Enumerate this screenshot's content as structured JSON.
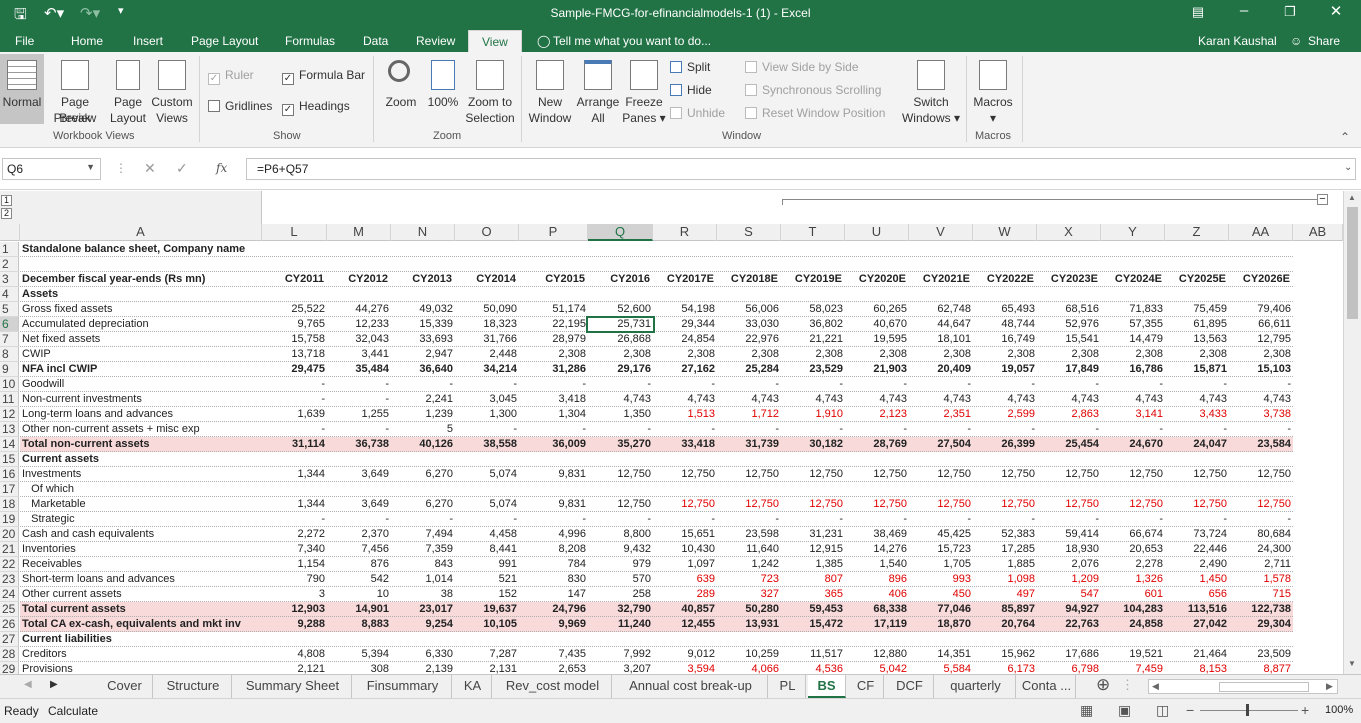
{
  "title_bar": {
    "title": "Sample-FMCG-for-efinancialmodels-1 (1) - Excel"
  },
  "menu": {
    "items": [
      "File",
      "Home",
      "Insert",
      "Page Layout",
      "Formulas",
      "Data",
      "Review",
      "View"
    ],
    "active": "View",
    "tell_me": "Tell me what you want to do...",
    "user": "Karan Kaushal",
    "share": "Share"
  },
  "ribbon": {
    "normal": "Normal",
    "page_break_1": "Page Break",
    "page_break_2": "Preview",
    "page_layout_1": "Page",
    "page_layout_2": "Layout",
    "custom_views_1": "Custom",
    "custom_views_2": "Views",
    "workbook_views": "Workbook Views",
    "ruler": "Ruler",
    "formula_bar": "Formula Bar",
    "gridlines": "Gridlines",
    "headings": "Headings",
    "show": "Show",
    "zoom": "Zoom",
    "zoom100": "100%",
    "zoom_sel_1": "Zoom to",
    "zoom_sel_2": "Selection",
    "zoom_group": "Zoom",
    "new_window_1": "New",
    "new_window_2": "Window",
    "arrange_1": "Arrange",
    "arrange_2": "All",
    "freeze_1": "Freeze",
    "freeze_2": "Panes",
    "split": "Split",
    "hide": "Hide",
    "unhide": "Unhide",
    "side_by_side": "View Side by Side",
    "sync_scroll": "Synchronous Scrolling",
    "reset_window": "Reset Window Position",
    "switch_1": "Switch",
    "switch_2": "Windows",
    "window_group": "Window",
    "macros": "Macros",
    "macros_group": "Macros"
  },
  "formula_bar": {
    "name_box": "Q6",
    "formula": "=P6+Q57"
  },
  "outline_levels": [
    "1",
    "2"
  ],
  "column_headers": [
    "A",
    "L",
    "M",
    "N",
    "O",
    "P",
    "Q",
    "R",
    "S",
    "T",
    "U",
    "V",
    "W",
    "X",
    "Y",
    "Z",
    "AA",
    "AB"
  ],
  "selected_cell": "Q6",
  "rows": [
    {
      "n": "1",
      "label": "Standalone balance sheet, Company name",
      "style": "bold",
      "values": []
    },
    {
      "n": "2",
      "label": "",
      "values": []
    },
    {
      "n": "3",
      "label": "December fiscal year-ends (Rs mn)",
      "style": "bold",
      "values": [
        "CY2011",
        "CY2012",
        "CY2013",
        "CY2014",
        "CY2015",
        "CY2016",
        "CY2017E",
        "CY2018E",
        "CY2019E",
        "CY2020E",
        "CY2021E",
        "CY2022E",
        "CY2023E",
        "CY2024E",
        "CY2025E",
        "CY2026E"
      ]
    },
    {
      "n": "4",
      "label": "Assets",
      "style": "bold",
      "values": []
    },
    {
      "n": "5",
      "label": "Gross fixed assets",
      "values": [
        "25,522",
        "44,276",
        "49,032",
        "50,090",
        "51,174",
        "52,600",
        "54,198",
        "56,006",
        "58,023",
        "60,265",
        "62,748",
        "65,493",
        "68,516",
        "71,833",
        "75,459",
        "79,406"
      ]
    },
    {
      "n": "6",
      "label": "Accumulated depreciation",
      "values": [
        "9,765",
        "12,233",
        "15,339",
        "18,323",
        "22,195",
        "25,731",
        "29,344",
        "33,030",
        "36,802",
        "40,670",
        "44,647",
        "48,744",
        "52,976",
        "57,355",
        "61,895",
        "66,611"
      ]
    },
    {
      "n": "7",
      "label": "Net fixed assets",
      "values": [
        "15,758",
        "32,043",
        "33,693",
        "31,766",
        "28,979",
        "26,868",
        "24,854",
        "22,976",
        "21,221",
        "19,595",
        "18,101",
        "16,749",
        "15,541",
        "14,479",
        "13,563",
        "12,795"
      ]
    },
    {
      "n": "8",
      "label": "CWIP",
      "values": [
        "13,718",
        "3,441",
        "2,947",
        "2,448",
        "2,308",
        "2,308",
        "2,308",
        "2,308",
        "2,308",
        "2,308",
        "2,308",
        "2,308",
        "2,308",
        "2,308",
        "2,308",
        "2,308"
      ]
    },
    {
      "n": "9",
      "label": "NFA incl CWIP",
      "style": "bold",
      "values": [
        "29,475",
        "35,484",
        "36,640",
        "34,214",
        "31,286",
        "29,176",
        "27,162",
        "25,284",
        "23,529",
        "21,903",
        "20,409",
        "19,057",
        "17,849",
        "16,786",
        "15,871",
        "15,103"
      ]
    },
    {
      "n": "10",
      "label": "Goodwill",
      "values": [
        "-",
        "-",
        "-",
        "-",
        "-",
        "-",
        "-",
        "-",
        "-",
        "-",
        "-",
        "-",
        "-",
        "-",
        "-",
        "-"
      ]
    },
    {
      "n": "11",
      "label": "Non-current investments",
      "values": [
        "-",
        "-",
        "2,241",
        "3,045",
        "3,418",
        "4,743",
        "4,743",
        "4,743",
        "4,743",
        "4,743",
        "4,743",
        "4,743",
        "4,743",
        "4,743",
        "4,743",
        "4,743"
      ]
    },
    {
      "n": "12",
      "label": "Long-term loans and advances",
      "values": [
        "1,639",
        "1,255",
        "1,239",
        "1,300",
        "1,304",
        "1,350",
        "1,513",
        "1,712",
        "1,910",
        "2,123",
        "2,351",
        "2,599",
        "2,863",
        "3,141",
        "3,433",
        "3,738"
      ],
      "red_from": 6
    },
    {
      "n": "13",
      "label": "Other non-current assets + misc exp",
      "values": [
        "-",
        "-",
        "5",
        "-",
        "-",
        "-",
        "-",
        "-",
        "-",
        "-",
        "-",
        "-",
        "-",
        "-",
        "-",
        "-"
      ]
    },
    {
      "n": "14",
      "label": "Total non-current assets",
      "style": "bold pink",
      "values": [
        "31,114",
        "36,738",
        "40,126",
        "38,558",
        "36,009",
        "35,270",
        "33,418",
        "31,739",
        "30,182",
        "28,769",
        "27,504",
        "26,399",
        "25,454",
        "24,670",
        "24,047",
        "23,584"
      ]
    },
    {
      "n": "15",
      "label": "Current assets",
      "style": "bold",
      "values": []
    },
    {
      "n": "16",
      "label": "Investments",
      "values": [
        "1,344",
        "3,649",
        "6,270",
        "5,074",
        "9,831",
        "12,750",
        "12,750",
        "12,750",
        "12,750",
        "12,750",
        "12,750",
        "12,750",
        "12,750",
        "12,750",
        "12,750",
        "12,750"
      ]
    },
    {
      "n": "17",
      "label": "   Of which",
      "values": []
    },
    {
      "n": "18",
      "label": "   Marketable",
      "values": [
        "1,344",
        "3,649",
        "6,270",
        "5,074",
        "9,831",
        "12,750",
        "12,750",
        "12,750",
        "12,750",
        "12,750",
        "12,750",
        "12,750",
        "12,750",
        "12,750",
        "12,750",
        "12,750"
      ],
      "red_from": 6
    },
    {
      "n": "19",
      "label": "   Strategic",
      "values": [
        "-",
        "-",
        "-",
        "-",
        "-",
        "-",
        "-",
        "-",
        "-",
        "-",
        "-",
        "-",
        "-",
        "-",
        "-",
        "-"
      ]
    },
    {
      "n": "20",
      "label": "Cash and cash equivalents",
      "values": [
        "2,272",
        "2,370",
        "7,494",
        "4,458",
        "4,996",
        "8,800",
        "15,651",
        "23,598",
        "31,231",
        "38,469",
        "45,425",
        "52,383",
        "59,414",
        "66,674",
        "73,724",
        "80,684"
      ]
    },
    {
      "n": "21",
      "label": "Inventories",
      "values": [
        "7,340",
        "7,456",
        "7,359",
        "8,441",
        "8,208",
        "9,432",
        "10,430",
        "11,640",
        "12,915",
        "14,276",
        "15,723",
        "17,285",
        "18,930",
        "20,653",
        "22,446",
        "24,300"
      ]
    },
    {
      "n": "22",
      "label": "Receivables",
      "values": [
        "1,154",
        "876",
        "843",
        "991",
        "784",
        "979",
        "1,097",
        "1,242",
        "1,385",
        "1,540",
        "1,705",
        "1,885",
        "2,076",
        "2,278",
        "2,490",
        "2,711"
      ]
    },
    {
      "n": "23",
      "label": "Short-term loans and advances",
      "values": [
        "790",
        "542",
        "1,014",
        "521",
        "830",
        "570",
        "639",
        "723",
        "807",
        "896",
        "993",
        "1,098",
        "1,209",
        "1,326",
        "1,450",
        "1,578"
      ],
      "red_from": 6
    },
    {
      "n": "24",
      "label": "Other current assets",
      "values": [
        "3",
        "10",
        "38",
        "152",
        "147",
        "258",
        "289",
        "327",
        "365",
        "406",
        "450",
        "497",
        "547",
        "601",
        "656",
        "715"
      ],
      "red_from": 6
    },
    {
      "n": "25",
      "label": "Total current assets",
      "style": "bold pink",
      "values": [
        "12,903",
        "14,901",
        "23,017",
        "19,637",
        "24,796",
        "32,790",
        "40,857",
        "50,280",
        "59,453",
        "68,338",
        "77,046",
        "85,897",
        "94,927",
        "104,283",
        "113,516",
        "122,738"
      ]
    },
    {
      "n": "26",
      "label": "Total CA ex-cash, equivalents and mkt inv",
      "style": "bold pink",
      "values": [
        "9,288",
        "8,883",
        "9,254",
        "10,105",
        "9,969",
        "11,240",
        "12,455",
        "13,931",
        "15,472",
        "17,119",
        "18,870",
        "20,764",
        "22,763",
        "24,858",
        "27,042",
        "29,304"
      ]
    },
    {
      "n": "27",
      "label": "Current liabilities",
      "style": "bold",
      "values": []
    },
    {
      "n": "28",
      "label": "Creditors",
      "values": [
        "4,808",
        "5,394",
        "6,330",
        "7,287",
        "7,435",
        "7,992",
        "9,012",
        "10,259",
        "11,517",
        "12,880",
        "14,351",
        "15,962",
        "17,686",
        "19,521",
        "21,464",
        "23,509"
      ]
    },
    {
      "n": "29",
      "label": "Provisions",
      "values": [
        "2,121",
        "308",
        "2,139",
        "2,131",
        "2,653",
        "3,207",
        "3,594",
        "4,066",
        "4,536",
        "5,042",
        "5,584",
        "6,173",
        "6,798",
        "7,459",
        "8,153",
        "8,877"
      ],
      "red_from": 6
    }
  ],
  "sheet_tabs": [
    "Cover",
    "Structure",
    "Summary Sheet",
    "Finsummary",
    "KA",
    "Rev_cost model",
    "Annual cost break-up",
    "PL",
    "BS",
    "CF",
    "DCF",
    "quarterly",
    "Conta ..."
  ],
  "active_tab": "BS",
  "status": {
    "ready": "Ready",
    "calculate": "Calculate",
    "zoom": "100%"
  }
}
